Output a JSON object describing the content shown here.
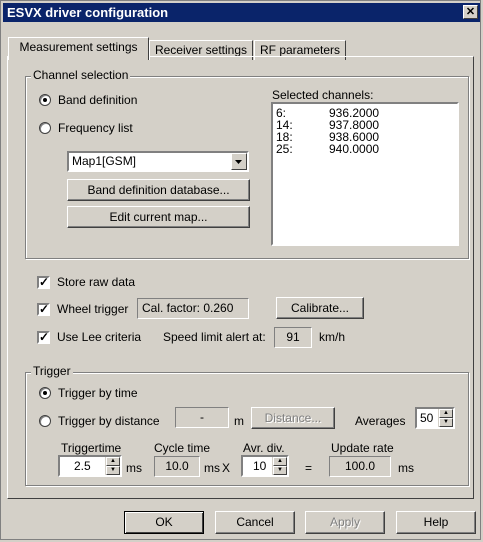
{
  "window": {
    "title": "ESVX driver configuration",
    "close_glyph": "✕"
  },
  "tabs": [
    {
      "label": "Measurement settings",
      "active": true
    },
    {
      "label": "Receiver settings",
      "active": false
    },
    {
      "label": "RF parameters",
      "active": false
    }
  ],
  "channel_selection": {
    "legend": "Channel selection",
    "band_definition_label": "Band definition",
    "frequency_list_label": "Frequency list",
    "selected_radio": "band_definition",
    "map_select_value": "Map1[GSM]",
    "band_db_button": "Band definition database...",
    "edit_map_button": "Edit current map...",
    "selected_channels_label": "Selected channels:",
    "selected_channels": [
      {
        "channel": "6:",
        "freq": "936.2000"
      },
      {
        "channel": "14:",
        "freq": "937.8000"
      },
      {
        "channel": "18:",
        "freq": "938.6000"
      },
      {
        "channel": "25:",
        "freq": "940.0000"
      }
    ]
  },
  "options": {
    "store_raw_label": "Store raw data",
    "store_raw_checked": true,
    "wheel_trigger_label": "Wheel trigger",
    "wheel_trigger_checked": true,
    "cal_factor_text": "Cal. factor: 0.260",
    "calibrate_button": "Calibrate...",
    "use_lee_label": "Use Lee criteria",
    "use_lee_checked": true,
    "speed_limit_label": "Speed limit alert at:",
    "speed_limit_value": "91",
    "speed_unit": "km/h"
  },
  "trigger": {
    "legend": "Trigger",
    "by_time_label": "Trigger by time",
    "by_distance_label": "Trigger by distance",
    "selected_radio": "by_time",
    "distance_value": "-",
    "distance_unit": "m",
    "distance_button": "Distance...",
    "averages_label": "Averages",
    "averages_value": "50",
    "triggertime_label": "Triggertime",
    "triggertime_value": "2.5",
    "triggertime_unit": "ms",
    "cycle_time_label": "Cycle time",
    "cycle_time_value": "10.0",
    "cycle_time_unit": "ms",
    "times_sign": "X",
    "avr_div_label": "Avr. div.",
    "avr_div_value": "10",
    "equals_sign": "=",
    "update_rate_label": "Update rate",
    "update_rate_value": "100.0",
    "update_rate_unit": "ms"
  },
  "footer": {
    "ok_button": "OK",
    "cancel_button": "Cancel",
    "apply_button": "Apply",
    "help_button": "Help"
  }
}
